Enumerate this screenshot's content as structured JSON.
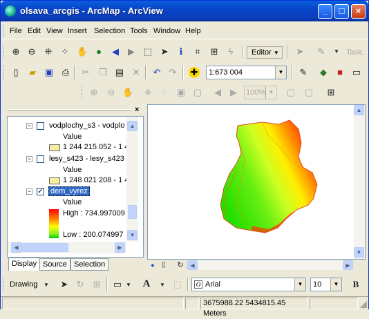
{
  "window": {
    "title": "olsava_arcgis - ArcMap - ArcView"
  },
  "menu": [
    "File",
    "Edit",
    "View",
    "Insert",
    "Selection",
    "Tools",
    "Window",
    "Help"
  ],
  "tools": {
    "editor_label": "Editor",
    "task_label": "Task:"
  },
  "standard": {
    "scale_value": "1:673 004"
  },
  "layout": {
    "zoom_value": "100%"
  },
  "toc": {
    "layers": [
      {
        "name": "vodplochy_s3 - vodplo",
        "legend_heading": "Value",
        "class_label": "1 244 215 052 - 1 4",
        "color": "#f4eda0",
        "checked": false
      },
      {
        "name": "lesy_s423 - lesy_s423",
        "legend_heading": "Value",
        "class_label": "1 248 021 208 - 1 4",
        "color": "#f4eda0",
        "checked": false
      },
      {
        "name": "dem_vyrez",
        "legend_heading": "Value",
        "high_label": "High : 734.997009",
        "low_label": "Low : 200.074997",
        "checked": true
      }
    ],
    "tabs": [
      "Display",
      "Source",
      "Selection"
    ]
  },
  "drawing": {
    "label": "Drawing",
    "font": "Arial",
    "size": "10",
    "bold": "B",
    "text_tool": "A"
  },
  "status": {
    "coords": "3675988.22  5434815.45 Meters"
  }
}
